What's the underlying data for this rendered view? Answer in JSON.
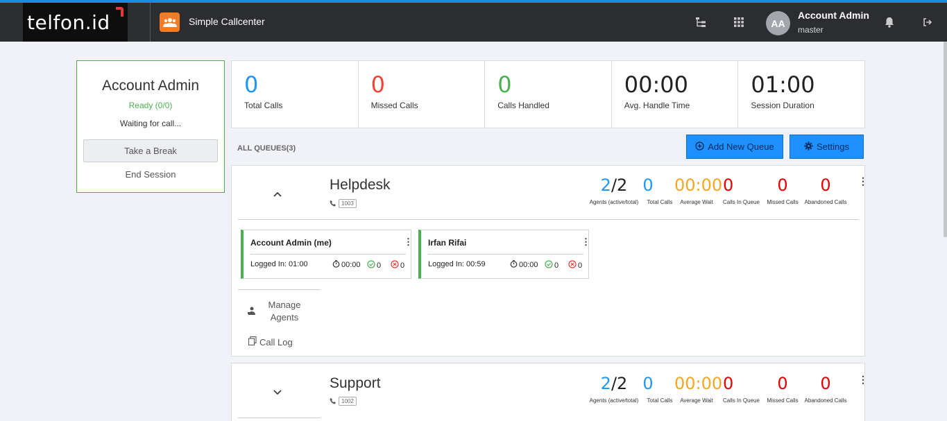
{
  "header": {
    "logo": "telfon.id",
    "app_title": "Simple Callcenter",
    "user": {
      "initials": "AA",
      "name": "Account Admin",
      "role": "master"
    },
    "icons": [
      "sitemap-icon",
      "grid-icon",
      "bell-icon",
      "logout-icon"
    ]
  },
  "agent": {
    "name": "Account Admin",
    "status": "Ready (0/0)",
    "message": "Waiting for call...",
    "break_label": "Take a Break",
    "end_label": "End Session"
  },
  "stats": [
    {
      "value": "0",
      "label": "Total Calls",
      "color": "#2196f3"
    },
    {
      "value": "0",
      "label": "Missed Calls",
      "color": "#f44336"
    },
    {
      "value": "0",
      "label": "Calls Handled",
      "color": "#4caf50"
    },
    {
      "value": "00:00",
      "label": "Avg. Handle Time",
      "color": "#222222"
    },
    {
      "value": "01:00",
      "label": "Session Duration",
      "color": "#222222"
    }
  ],
  "queues_header": "ALL QUEUES(3)",
  "buttons": {
    "add_queue": "Add New Queue",
    "settings": "Settings"
  },
  "queue_stat_labels": {
    "agents": "Agents (active/total)",
    "total": "Total Calls",
    "wait": "Average Wait",
    "in_queue": "Calls In Queue",
    "missed": "Missed Calls",
    "abandoned": "Abandoned Calls"
  },
  "queues": [
    {
      "name": "Helpdesk",
      "ext": "1003",
      "agents_active": "2",
      "agents_sep": "/2",
      "total": "0",
      "wait": "00:00",
      "in_queue": "0",
      "missed": "0",
      "abandoned": "0",
      "members": [
        {
          "name": "Account Admin (me)",
          "logged": "Logged In: 01:00",
          "time": "00:00",
          "ok": "0",
          "fail": "0"
        },
        {
          "name": "Irfan Rifai",
          "logged": "Logged In: 00:59",
          "time": "00:00",
          "ok": "0",
          "fail": "0"
        }
      ],
      "manage_label": "Manage Agents",
      "log_label": "Call Log"
    },
    {
      "name": "Support",
      "ext": "1002",
      "agents_active": "2",
      "agents_sep": "/2",
      "total": "0",
      "wait": "00:00",
      "in_queue": "0",
      "missed": "0",
      "abandoned": "0"
    }
  ],
  "colors": {
    "blue": "#2196f3",
    "orange": "#f5a623",
    "red": "#e60000",
    "green": "#4caf50"
  }
}
